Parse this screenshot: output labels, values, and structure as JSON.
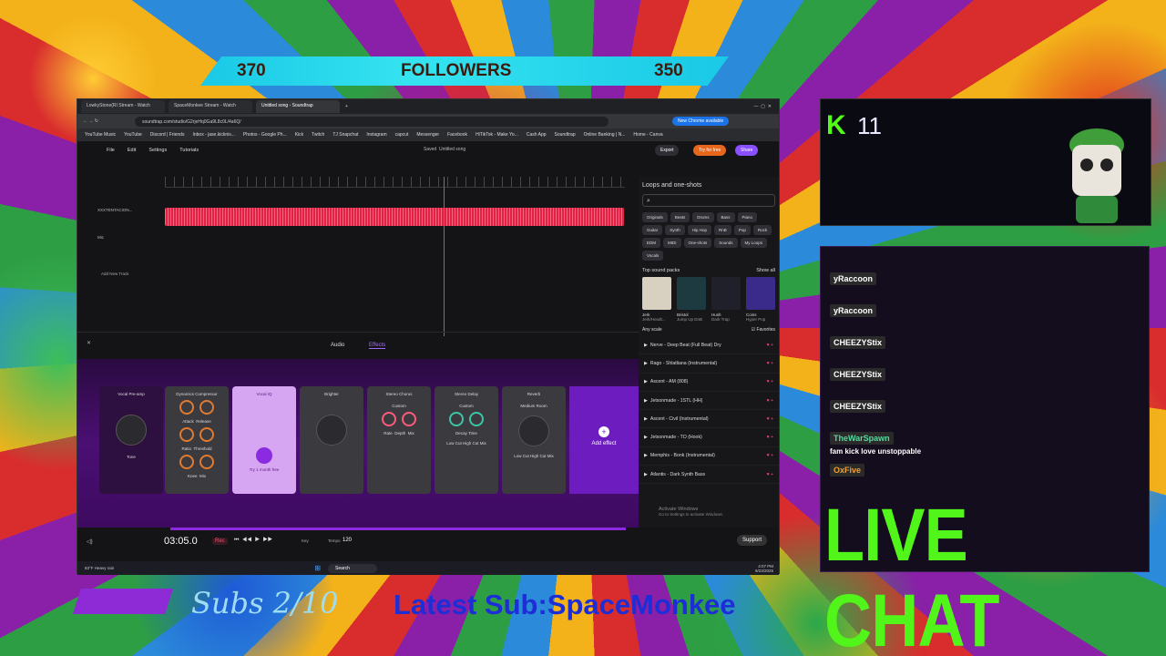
{
  "followers": {
    "left": "370",
    "label": "FOLLOWERS",
    "right": "350"
  },
  "browser": {
    "tabs": [
      "LowkyStone(RI Stream - Watch",
      "SpaceMonkee Stream - Watch",
      "Untitled song - Soundtrap"
    ],
    "url": "soundtrap.com/studio/G2rjeHq0Ga9L8c0L/4a6Q/",
    "chrome_badge": "New Chrome available",
    "bookmarks": [
      "YouTube Music",
      "YouTube",
      "Discord | Friends",
      "Inbox - jase.kicknis...",
      "Photos - Google Ph...",
      "Kick",
      "Twitch",
      "TJ Snapchat",
      "Instagram",
      "capcut",
      "Messenger",
      "Facebook",
      "HiTikTok - Make Yo...",
      "Cash App",
      "Soundtrap",
      "Online Banking | N...",
      "Home - Canva"
    ]
  },
  "app": {
    "menu": [
      "File",
      "Edit",
      "Settings",
      "Tutorials"
    ],
    "saved": "Saved",
    "song_title": "Untitled song",
    "buttons": {
      "export": "Export",
      "try": "Try for free",
      "share": "Share"
    },
    "tracks": [
      {
        "name": "XXXTENTACION..."
      },
      {
        "name": "Mic"
      }
    ],
    "add_track": "Add New Track",
    "panel_tabs": {
      "audio": "Audio",
      "effects": "Effects"
    },
    "effects": [
      {
        "name": "Vocal Pre-amp",
        "knob": "Tone"
      },
      {
        "name": "Dynamics Compressor",
        "knobs": [
          "Attack",
          "Release",
          "Ratio",
          "Threshold",
          "Knee",
          "Mix"
        ]
      },
      {
        "name": "Vocal IQ",
        "cta": "Try 1 month free"
      },
      {
        "name": "Brighter"
      },
      {
        "name": "Stereo Chorus",
        "preset": "Custom",
        "knobs": [
          "Rate",
          "Depth",
          "Mix"
        ]
      },
      {
        "name": "Stereo Delay",
        "preset": "Custom",
        "knobs": [
          "Decay",
          "Time",
          "Low Cut",
          "High Cut",
          "Mix"
        ]
      },
      {
        "name": "Reverb",
        "preset": "Medium Room",
        "knobs": [
          "Low Cut",
          "High Cut",
          "Mix"
        ]
      }
    ],
    "add_effect": "Add effect",
    "time": "03:05.0",
    "rec": "Rec",
    "key": "Key",
    "tempo_label": "Tempo",
    "tempo": "120",
    "support": "Support"
  },
  "sidebar": {
    "title": "Loops and one-shots",
    "chips": [
      "Originals",
      "Beats",
      "Drums",
      "Bass",
      "Piano",
      "Guitar",
      "Synth",
      "Hip Hop",
      "RnB",
      "Pop",
      "Rock",
      "EDM",
      "MIDI",
      "One-shots",
      "Sounds",
      "My Loops",
      "Vocals"
    ],
    "top_packs_label": "Top sound packs",
    "show_all": "Show all",
    "packs": [
      {
        "name": "Jerk",
        "sub": "Jerk/Hoodt..."
      },
      {
        "name": "Bristol",
        "sub": "Jump Up DnB"
      },
      {
        "name": "Hush",
        "sub": "Dark Trap"
      },
      {
        "name": "Coins",
        "sub": "Hyper Pop"
      }
    ],
    "scale": "Any scale",
    "favorites": "Favorites",
    "loops": [
      "Nerve - Deep Beat (Full Beat) Dry",
      "Rago - Shlatliana (Instrumental)",
      "Ascent - AM (808)",
      "Jetsonmade - 1STL (HH)",
      "Ascent - Civil (Instrumental)",
      "Jetsonmade - TO (Hook)",
      "Memphis - Bonk (Instrumental)",
      "Atlantis - Dark Synth Bass"
    ],
    "activate": "Activate Windows",
    "activate_sub": "Go to Settings to activate Windows."
  },
  "taskbar": {
    "weather": "83°F Heavy rain",
    "search": "Search",
    "clock": "4:07 PM",
    "date": "9/23/2025"
  },
  "kick": {
    "logo": "K",
    "count": "11"
  },
  "chat": {
    "messages": [
      {
        "user": "yRaccoon",
        "text": ""
      },
      {
        "user": "yRaccoon",
        "text": ""
      },
      {
        "user": "CHEEZYStix",
        "text": ""
      },
      {
        "user": "CHEEZYStix",
        "text": ""
      },
      {
        "user": "CHEEZYStix",
        "text": ""
      },
      {
        "user": "TheWarSpawn",
        "text": "fam kick love unstoppable"
      },
      {
        "user": "OxFive",
        "text": ""
      }
    ],
    "banner": "LIVE CHAT"
  },
  "bottom": {
    "subs": "Subs 2/10",
    "latest": "Latest Sub:SpaceMonkee"
  },
  "colors": {
    "accent_purple": "#8a2be2",
    "waveform": "#e22145",
    "kick_green": "#53fc18",
    "followers_bar": "#19c9e6"
  }
}
